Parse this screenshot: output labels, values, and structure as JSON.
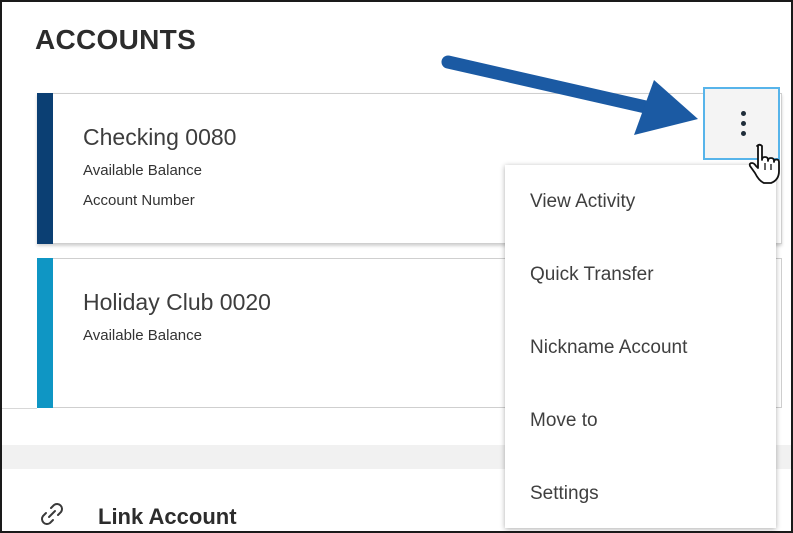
{
  "header": {
    "title": "ACCOUNTS"
  },
  "accounts": [
    {
      "name": "Checking 0080",
      "lines": [
        "Available Balance",
        "Account Number"
      ],
      "accent_color": "#0b3f73"
    },
    {
      "name": "Holiday Club 0020",
      "lines": [
        "Available Balance"
      ],
      "accent_color": "#0f96c4"
    }
  ],
  "actions_menu": {
    "button_icon": "kebab-menu-icon",
    "items": [
      {
        "label": "View Activity"
      },
      {
        "label": "Quick Transfer"
      },
      {
        "label": "Nickname Account"
      },
      {
        "label": "Move to"
      },
      {
        "label": "Settings"
      }
    ]
  },
  "link_account": {
    "label": "Link Account",
    "icon": "link-icon"
  },
  "annotation": {
    "icon": "arrow-icon",
    "color": "#1b5aa3"
  },
  "pointer": {
    "icon": "hand-cursor-icon"
  },
  "colors": {
    "focus_ring": "#57b4ea",
    "text_primary": "#2c2c2c"
  }
}
